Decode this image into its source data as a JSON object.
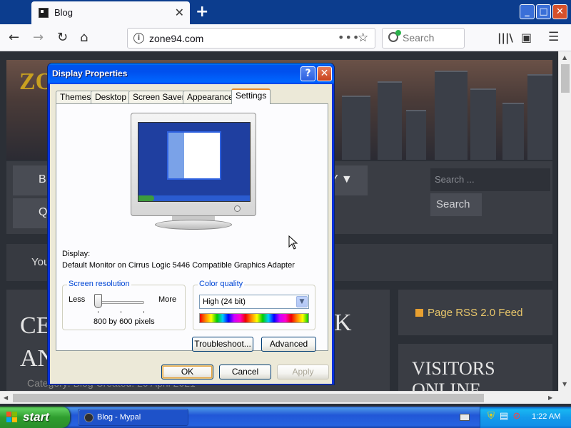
{
  "browser": {
    "tab_title": "Blog",
    "url": "zone94.com",
    "search_placeholder": "Search"
  },
  "website": {
    "logo": "ZO",
    "menu_left_1": "B",
    "menu_left_2": "Q",
    "menu_right": "Y ▼",
    "search_placeholder": "Search ...",
    "search_button": "Search",
    "notice_fragment": "You",
    "article_title": "CE\nAN",
    "article_title_right": "K",
    "article_meta": "Category: Blog    Created: 20 April 2021",
    "rss_link": "Page RSS 2.0 Feed",
    "visitors_heading": "VISITORS\nONLINE"
  },
  "dialog": {
    "title": "Display Properties",
    "tabs": [
      "Themes",
      "Desktop",
      "Screen Saver",
      "Appearance",
      "Settings"
    ],
    "active_tab": "Settings",
    "display_label": "Display:",
    "display_value": "Default Monitor on Cirrus Logic 5446 Compatible Graphics Adapter",
    "screen_resolution": {
      "title": "Screen resolution",
      "less": "Less",
      "more": "More",
      "value": "800 by 600 pixels",
      "slider_level": 0
    },
    "color_quality": {
      "title": "Color quality",
      "selected": "High (24 bit)"
    },
    "buttons": {
      "troubleshoot": "Troubleshoot...",
      "advanced": "Advanced",
      "ok": "OK",
      "cancel": "Cancel",
      "apply": "Apply"
    }
  },
  "taskbar": {
    "start": "start",
    "item": "Blog - Mypal",
    "clock": "1:22 AM"
  }
}
